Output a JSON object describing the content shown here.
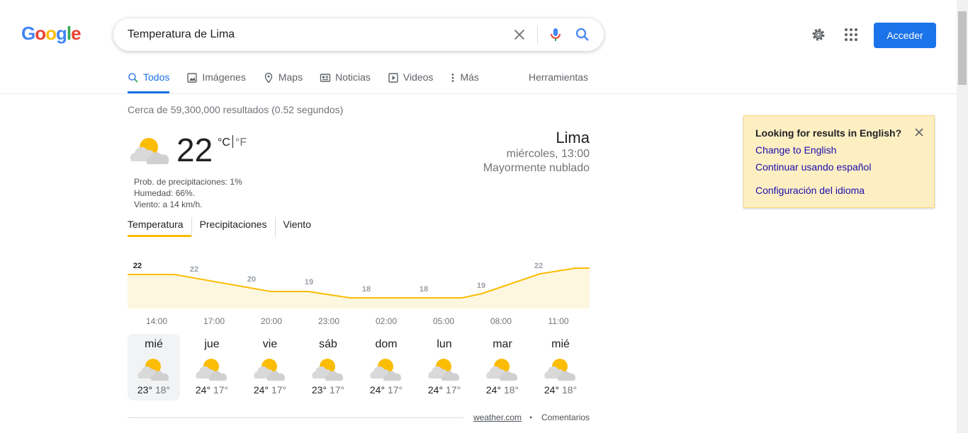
{
  "logo": {
    "text": "Google"
  },
  "search": {
    "query": "Temperatura de Lima"
  },
  "header": {
    "signin_label": "Acceder"
  },
  "tabs": [
    {
      "label": "Todos",
      "icon": "search-icon",
      "active": true
    },
    {
      "label": "Imágenes",
      "icon": "image-icon"
    },
    {
      "label": "Maps",
      "icon": "map-pin-icon"
    },
    {
      "label": "Noticias",
      "icon": "news-icon"
    },
    {
      "label": "Videos",
      "icon": "play-icon"
    },
    {
      "label": "Más",
      "icon": "more-vert-icon"
    }
  ],
  "tools_label": "Herramientas",
  "results_count": "Cerca de 59,300,000 resultados (0.52 segundos)",
  "weather": {
    "temp": "22",
    "unit_c": "°C",
    "unit_f": "°F",
    "precip": "Prob. de precipitaciones: 1%",
    "humidity": "Humedad: 66%.",
    "wind": "Viento: a 14 km/h.",
    "city": "Lima",
    "datetime": "miércoles, 13:00",
    "condition": "Mayormente nublado",
    "tabs": [
      "Temperatura",
      "Precipitaciones",
      "Viento"
    ],
    "chart_values": [
      "22",
      "22",
      "20",
      "19",
      "18",
      "18",
      "19",
      "22"
    ],
    "hours": [
      "14:00",
      "17:00",
      "20:00",
      "23:00",
      "02:00",
      "05:00",
      "08:00",
      "11:00"
    ],
    "days": [
      {
        "name": "mié",
        "hi": "23°",
        "lo": "18°"
      },
      {
        "name": "jue",
        "hi": "24°",
        "lo": "17°"
      },
      {
        "name": "vie",
        "hi": "24°",
        "lo": "17°"
      },
      {
        "name": "sáb",
        "hi": "23°",
        "lo": "17°"
      },
      {
        "name": "dom",
        "hi": "24°",
        "lo": "17°"
      },
      {
        "name": "lun",
        "hi": "24°",
        "lo": "17°"
      },
      {
        "name": "mar",
        "hi": "24°",
        "lo": "18°"
      },
      {
        "name": "mié",
        "hi": "24°",
        "lo": "18°"
      }
    ],
    "source": "weather.com",
    "separator": "•",
    "feedback": "Comentarios"
  },
  "lang_popup": {
    "title": "Looking for results in English?",
    "change": "Change to English",
    "continue": "Continuar usando español",
    "settings": "Configuración del idioma"
  },
  "colors": {
    "accent": "#1a73e8",
    "sun": "#fbbc04",
    "popup_bg": "#feefc3",
    "link": "#1a0dab"
  }
}
